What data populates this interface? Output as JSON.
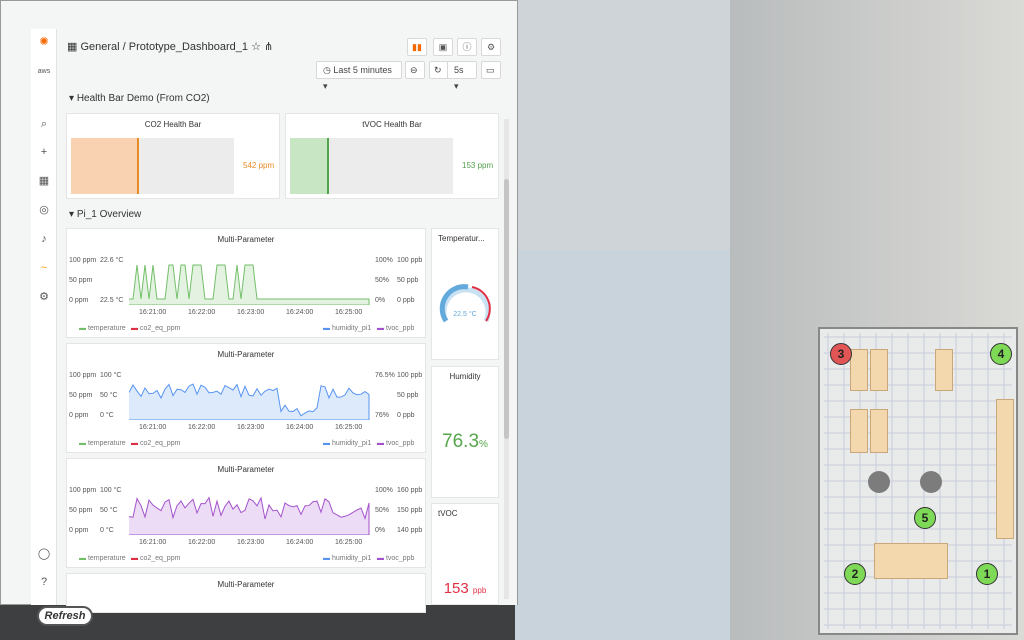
{
  "header": {
    "folder": "General",
    "separator": "/",
    "dashboard": "Prototype_Dashboard_1",
    "time_range": "Last 5 minutes",
    "refresh_interval": "5s"
  },
  "rows": [
    {
      "label": "Health Bar Demo (From CO2)"
    },
    {
      "label": "Pi_1 Overview"
    }
  ],
  "health": {
    "co2": {
      "title": "CO2 Health Bar",
      "value": "542 ppm",
      "color": "#e88b25",
      "fraction": 0.42
    },
    "tvoc": {
      "title": "tVOC Health Bar",
      "value": "153 ppm",
      "color": "#52a34d",
      "fraction": 0.24
    }
  },
  "graphs": [
    {
      "title": "Multi-Parameter",
      "left_ticks": [
        "100 ppm",
        "50 ppm",
        "0 ppm"
      ],
      "left_ticks2": [
        "22.6 °C",
        "",
        "22.5 °C"
      ],
      "right_ticks": [
        "100%",
        "50%",
        "0%"
      ],
      "right_ticks2": [
        "100 ppb",
        "50 ppb",
        "0 ppb"
      ],
      "x_ticks": [
        "16:21:00",
        "16:22:00",
        "16:23:00",
        "16:24:00",
        "16:25:00"
      ],
      "legend": [
        "temperature",
        "co2_eq_ppm",
        "humidity_pi1",
        "tvoc_ppb"
      ],
      "series_color": "#73bf69"
    },
    {
      "title": "Multi-Parameter",
      "left_ticks": [
        "100 ppm",
        "50 ppm",
        "0 ppm"
      ],
      "left_ticks2": [
        "100 °C",
        "50 °C",
        "0 °C"
      ],
      "right_ticks": [
        "76.5%",
        "",
        "76%"
      ],
      "right_ticks2": [
        "100 ppb",
        "50 ppb",
        "0 ppb"
      ],
      "x_ticks": [
        "16:21:00",
        "16:22:00",
        "16:23:00",
        "16:24:00",
        "16:25:00"
      ],
      "legend": [
        "temperature",
        "co2_eq_ppm",
        "humidity_pi1",
        "tvoc_ppb"
      ],
      "series_color": "#5794f2"
    },
    {
      "title": "Multi-Parameter",
      "left_ticks": [
        "100 ppm",
        "50 ppm",
        "0 ppm"
      ],
      "left_ticks2": [
        "100 °C",
        "50 °C",
        "0 °C"
      ],
      "right_ticks": [
        "100%",
        "50%",
        "0%"
      ],
      "right_ticks2": [
        "160 ppb",
        "150 ppb",
        "140 ppb"
      ],
      "x_ticks": [
        "16:21:00",
        "16:22:00",
        "16:23:00",
        "16:24:00",
        "16:25:00"
      ],
      "legend": [
        "temperature",
        "co2_eq_ppm",
        "humidity_pi1",
        "tvoc_ppb"
      ],
      "series_color": "#a352cc"
    },
    {
      "title": "Multi-Parameter"
    }
  ],
  "stats": {
    "temperature": {
      "title": "Temperatur...",
      "value": "22.5 °C"
    },
    "humidity": {
      "title": "Humidity",
      "value": "76.3",
      "unit": "%",
      "color": "#56a64b"
    },
    "tvoc": {
      "title": "tVOC",
      "value": "153",
      "unit": "ppb",
      "color": "#e02f44"
    }
  },
  "refresh_label": "Refresh",
  "markers": [
    {
      "label": "3",
      "color": "#e25555"
    },
    {
      "label": "4",
      "color": "#7ed957"
    },
    {
      "label": "5",
      "color": "#7ed957"
    },
    {
      "label": "2",
      "color": "#7ed957"
    },
    {
      "label": "1",
      "color": "#7ed957"
    }
  ]
}
